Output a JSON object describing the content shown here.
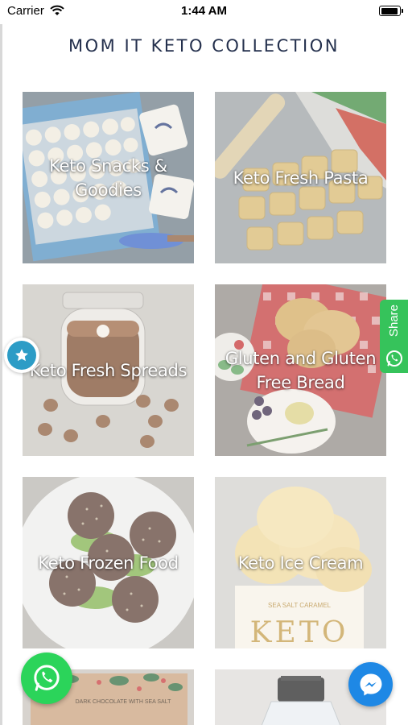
{
  "status_bar": {
    "carrier": "Carrier",
    "time": "1:44 AM",
    "wifi_icon": "wifi-icon",
    "battery_icon": "battery-icon"
  },
  "header": {
    "title": "MOM IT KETO COLLECTION"
  },
  "collections": [
    {
      "label": "Keto Snacks & Goodies"
    },
    {
      "label": "Keto Fresh Pasta"
    },
    {
      "label": "Keto Fresh Spreads"
    },
    {
      "label": "Gluten and Gluten Free Bread"
    },
    {
      "label": "Keto Frozen Food"
    },
    {
      "label": "Keto Ice Cream"
    },
    {
      "label": ""
    },
    {
      "label": ""
    }
  ],
  "product_text": {
    "ice_cream_lid": "SEA SALT CARAMEL",
    "ice_cream_brand": "KETO",
    "chocolate_bar": "DARK CHOCOLATE WITH SEA SALT"
  },
  "widgets": {
    "share_label": "Share",
    "star_icon": "star-icon",
    "whatsapp_icon": "whatsapp-icon",
    "messenger_icon": "messenger-icon"
  },
  "colors": {
    "title": "#24304d",
    "share_green": "#36c35b",
    "whatsapp_green": "#2bd45a",
    "messenger_blue": "#1e88e5",
    "star_blue": "#2c9cc6"
  }
}
